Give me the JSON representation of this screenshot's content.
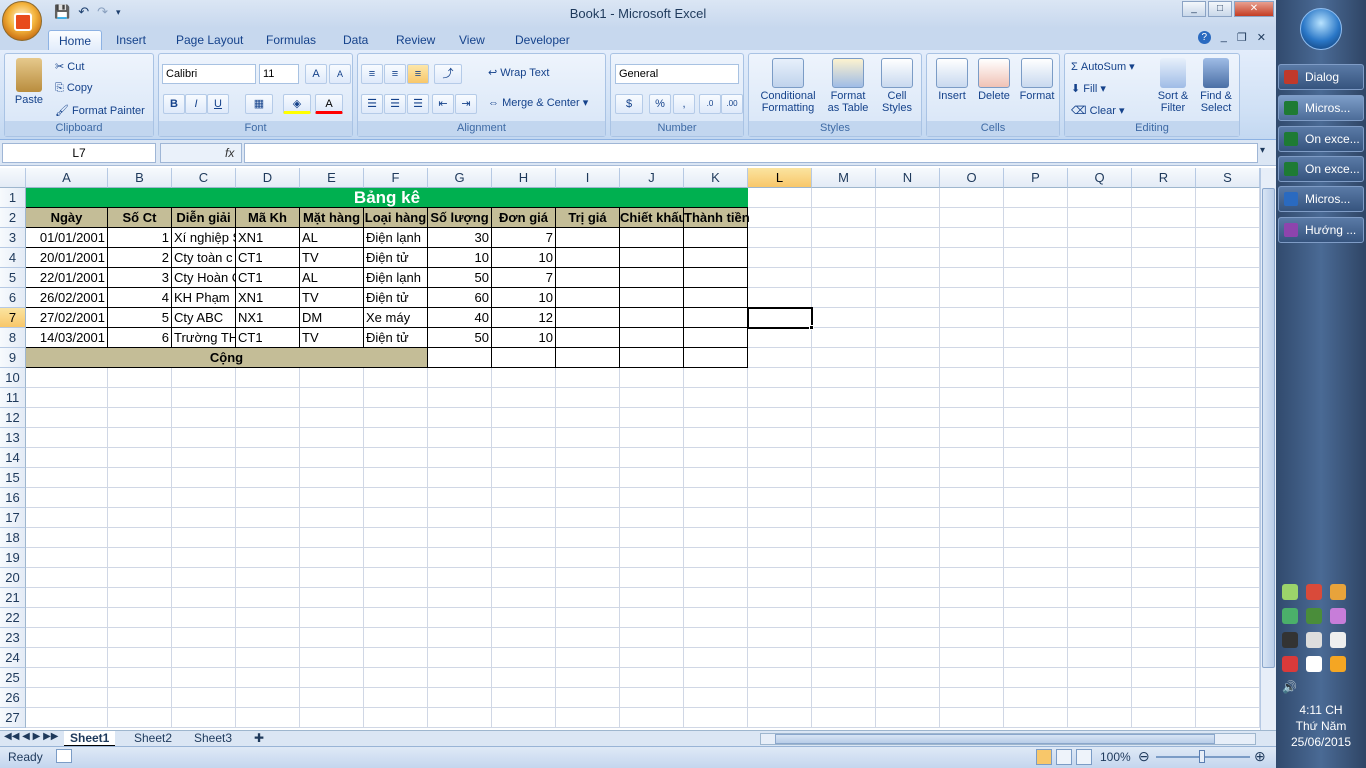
{
  "window": {
    "title": "Book1 - Microsoft Excel",
    "controls": [
      "_",
      "□",
      "✕"
    ]
  },
  "tabs": [
    "Home",
    "Insert",
    "Page Layout",
    "Formulas",
    "Data",
    "Review",
    "View",
    "Developer"
  ],
  "active_tab": "Home",
  "ribbon": {
    "clipboard": {
      "title": "Clipboard",
      "paste": "Paste",
      "cut": "Cut",
      "copy": "Copy",
      "format_painter": "Format Painter"
    },
    "font": {
      "title": "Font",
      "font_name": "Calibri",
      "font_size": "11",
      "bold": "B",
      "italic": "I",
      "underline": "U"
    },
    "alignment": {
      "title": "Alignment",
      "wrap_text": "Wrap Text",
      "merge_center": "Merge & Center"
    },
    "number": {
      "title": "Number",
      "format": "General",
      "percent": "%",
      "comma": ","
    },
    "styles": {
      "title": "Styles",
      "conditional": "Conditional",
      "conditional2": "Formatting",
      "format_as": "Format",
      "format_as2": "as Table",
      "cell": "Cell",
      "cell2": "Styles"
    },
    "cells": {
      "title": "Cells",
      "insert": "Insert",
      "delete": "Delete",
      "format": "Format"
    },
    "editing": {
      "title": "Editing",
      "autosum": "AutoSum",
      "fill": "Fill",
      "clear": "Clear",
      "sort": "Sort &",
      "sort2": "Filter",
      "find": "Find &",
      "find2": "Select"
    }
  },
  "formula_bar": {
    "name_box": "L7",
    "fx": "fx",
    "value": ""
  },
  "columns": [
    "A",
    "B",
    "C",
    "D",
    "E",
    "F",
    "G",
    "H",
    "I",
    "J",
    "K",
    "L",
    "M",
    "N",
    "O",
    "P",
    "Q",
    "R",
    "S"
  ],
  "selected_column": "L",
  "rows": [
    "1",
    "2",
    "3",
    "4",
    "5",
    "6",
    "7",
    "8",
    "9",
    "10",
    "11",
    "12",
    "13",
    "14",
    "15",
    "16",
    "17",
    "18",
    "19",
    "20",
    "21",
    "22",
    "23",
    "24",
    "25",
    "26",
    "27"
  ],
  "selected_row": "7",
  "sheet": {
    "title": "Bảng kê",
    "headers": [
      "Ngày",
      "Số Ct",
      "Diễn giải",
      "Mã Kh",
      "Mặt hàng",
      "Loại hàng",
      "Số lượng",
      "Đơn giá",
      "Trị giá",
      "Chiết khấu",
      "Thành tiền"
    ],
    "data": [
      [
        "01/01/2001",
        "1",
        "Xí nghiệp S",
        "XN1",
        "AL",
        "Điện lạnh",
        "30",
        "7",
        "",
        "",
        ""
      ],
      [
        "20/01/2001",
        "2",
        "Cty toàn c",
        "CT1",
        "TV",
        "Điện tử",
        "10",
        "10",
        "",
        "",
        ""
      ],
      [
        "22/01/2001",
        "3",
        "Cty Hoàn C",
        "CT1",
        "AL",
        "Điện lạnh",
        "50",
        "7",
        "",
        "",
        ""
      ],
      [
        "26/02/2001",
        "4",
        "KH Phạm",
        "XN1",
        "TV",
        "Điện tử",
        "60",
        "10",
        "",
        "",
        ""
      ],
      [
        "27/02/2001",
        "5",
        "Cty ABC",
        "NX1",
        "DM",
        "Xe máy",
        "40",
        "12",
        "",
        "",
        ""
      ],
      [
        "14/03/2001",
        "6",
        "Trường TH",
        "CT1",
        "TV",
        "Điện tử",
        "50",
        "10",
        "",
        "",
        ""
      ]
    ],
    "total_label": "Cộng"
  },
  "sheet_tabs": [
    "Sheet1",
    "Sheet2",
    "Sheet3"
  ],
  "active_sheet": "Sheet1",
  "status": {
    "ready": "Ready",
    "zoom": "100%"
  },
  "taskbar": {
    "items": [
      "Dialog",
      "Micros...",
      "On exce...",
      "On exce...",
      "Micros...",
      "Hướng ..."
    ],
    "clock_time": "4:11 CH",
    "clock_day": "Thứ Năm",
    "clock_date": "25/06/2015"
  },
  "colors": {
    "title_green": "#00b050",
    "header_tan": "#c4bd97",
    "selection_orange": "#f8c76a"
  }
}
